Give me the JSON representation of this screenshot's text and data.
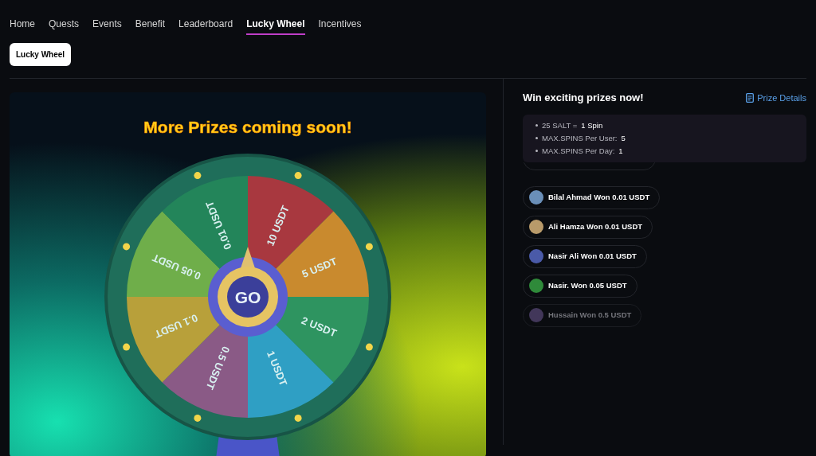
{
  "nav": [
    {
      "label": "Home",
      "selected": false
    },
    {
      "label": "Quests",
      "selected": false
    },
    {
      "label": "Events",
      "selected": false
    },
    {
      "label": "Benefit",
      "selected": false
    },
    {
      "label": "Leaderboard",
      "selected": false
    },
    {
      "label": "Lucky Wheel",
      "selected": true
    },
    {
      "label": "Incentives",
      "selected": false
    }
  ],
  "sub_tabs": [
    {
      "label": "Lucky Wheel",
      "selected": true
    }
  ],
  "wheel": {
    "title": "More Prizes coming soon!",
    "button": "GO",
    "segments": [
      {
        "label": "10 USDT",
        "color": "#a8383f"
      },
      {
        "label": "5 USDT",
        "color": "#c98a2e"
      },
      {
        "label": "2 USDT",
        "color": "#2e9460"
      },
      {
        "label": "1 USDT",
        "color": "#2f9fc4"
      },
      {
        "label": "0.5 USDT",
        "color": "#8a5a86"
      },
      {
        "label": "0.1 USDT",
        "color": "#b8a03a"
      },
      {
        "label": "0.05 USDT",
        "color": "#6fae4a"
      },
      {
        "label": "0.01 USDT",
        "color": "#23855a"
      }
    ]
  },
  "info": {
    "title": "Win exciting prizes now!",
    "link": "Prize Details",
    "rules": [
      {
        "label": "25 SALT = ",
        "value": "1 Spin"
      },
      {
        "label": "MAX.SPINS Per User: ",
        "value": "5"
      },
      {
        "label": "MAX.SPINS Per Day: ",
        "value": "1"
      }
    ]
  },
  "winners": [
    {
      "text": "Bilal Ahmad Won 0.01 USDT",
      "faded": false
    },
    {
      "text": "Ali Hamza Won 0.01 USDT",
      "faded": false
    },
    {
      "text": "Nasir Ali Won 0.01 USDT",
      "faded": false
    },
    {
      "text": "Nasir. Won 0.05 USDT",
      "faded": false
    },
    {
      "text": "Hussain Won 0.5 USDT",
      "faded": true
    }
  ]
}
